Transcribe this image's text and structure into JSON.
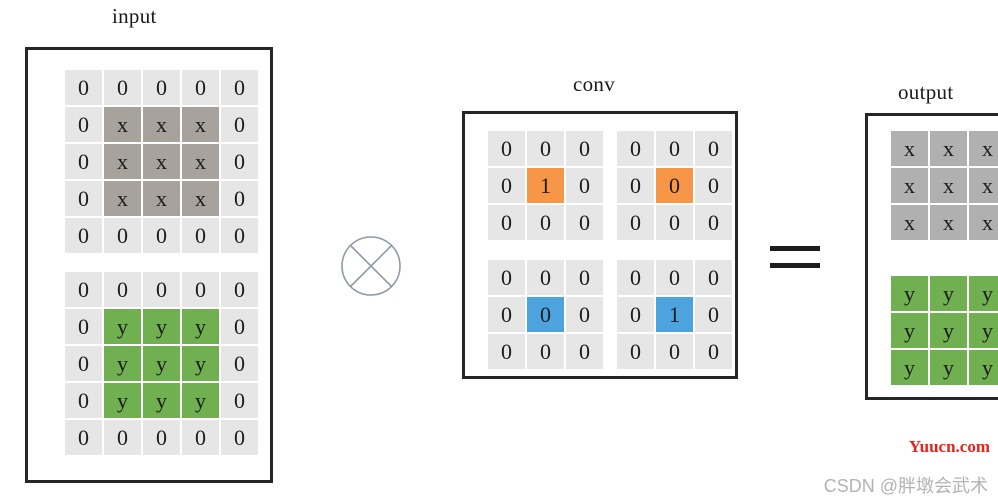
{
  "diagram": {
    "title_input": "input",
    "title_conv": "conv",
    "title_output": "output",
    "operator_symbol": "circle-times",
    "equals_symbol": "="
  },
  "colors": {
    "zero_cell": "#e6e6e6",
    "x_cell": "#a8a29c",
    "y_cell": "#70b050",
    "orange_cell": "#f79646",
    "blue_cell": "#4da3dd",
    "output_x_cell": "#b0b0b0",
    "border": "#262626",
    "watermark_red": "#e8231b",
    "watermark_gray": "#b3b3b3"
  },
  "input_panel": {
    "channel_x": {
      "rows": [
        [
          "0",
          "0",
          "0",
          "0",
          "0"
        ],
        [
          "0",
          "x",
          "x",
          "x",
          "0"
        ],
        [
          "0",
          "x",
          "x",
          "x",
          "0"
        ],
        [
          "0",
          "x",
          "x",
          "x",
          "0"
        ],
        [
          "0",
          "0",
          "0",
          "0",
          "0"
        ]
      ]
    },
    "channel_y": {
      "rows": [
        [
          "0",
          "0",
          "0",
          "0",
          "0"
        ],
        [
          "0",
          "y",
          "y",
          "y",
          "0"
        ],
        [
          "0",
          "y",
          "y",
          "y",
          "0"
        ],
        [
          "0",
          "y",
          "y",
          "y",
          "0"
        ],
        [
          "0",
          "0",
          "0",
          "0",
          "0"
        ]
      ]
    }
  },
  "conv_panel": {
    "kernels": [
      {
        "name": "kernel-top-left",
        "rows": [
          [
            "0",
            "0",
            "0"
          ],
          [
            "0",
            "1",
            "0"
          ],
          [
            "0",
            "0",
            "0"
          ]
        ],
        "highlight": "orange",
        "highlight_row": 1,
        "highlight_col": 1
      },
      {
        "name": "kernel-top-right",
        "rows": [
          [
            "0",
            "0",
            "0"
          ],
          [
            "0",
            "0",
            "0"
          ],
          [
            "0",
            "0",
            "0"
          ]
        ],
        "highlight": "orange",
        "highlight_row": 1,
        "highlight_col": 1
      },
      {
        "name": "kernel-bottom-left",
        "rows": [
          [
            "0",
            "0",
            "0"
          ],
          [
            "0",
            "0",
            "0"
          ],
          [
            "0",
            "0",
            "0"
          ]
        ],
        "highlight": "blue",
        "highlight_row": 1,
        "highlight_col": 1
      },
      {
        "name": "kernel-bottom-right",
        "rows": [
          [
            "0",
            "0",
            "0"
          ],
          [
            "0",
            "1",
            "0"
          ],
          [
            "0",
            "0",
            "0"
          ]
        ],
        "highlight": "blue",
        "highlight_row": 1,
        "highlight_col": 1
      }
    ]
  },
  "output_panel": {
    "channel_x": {
      "rows": [
        [
          "x",
          "x",
          "x"
        ],
        [
          "x",
          "x",
          "x"
        ],
        [
          "x",
          "x",
          "x"
        ]
      ]
    },
    "channel_y": {
      "rows": [
        [
          "y",
          "y",
          "y"
        ],
        [
          "y",
          "y",
          "y"
        ],
        [
          "y",
          "y",
          "y"
        ]
      ]
    }
  },
  "watermarks": {
    "primary": "Yuucn.com",
    "secondary": "CSDN @胖墩会武术"
  }
}
